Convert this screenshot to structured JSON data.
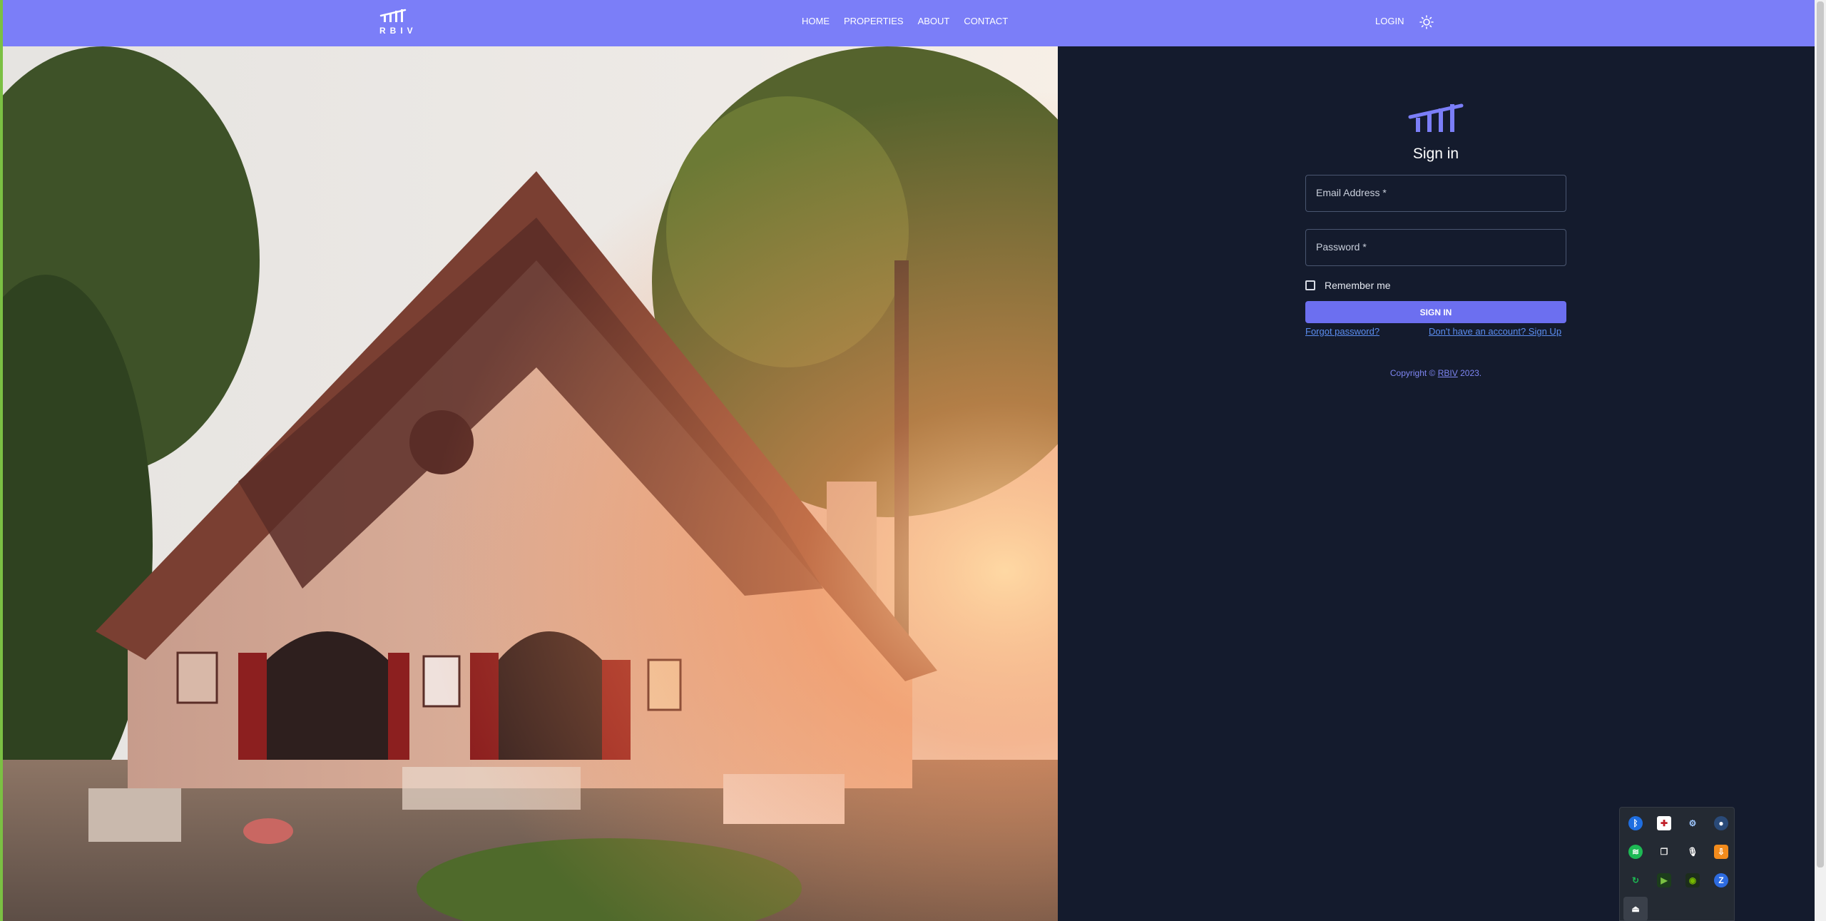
{
  "navbar": {
    "brand_text": "RBIV",
    "links": [
      "HOME",
      "PROPERTIES",
      "ABOUT",
      "CONTACT"
    ],
    "login_label": "LOGIN",
    "theme_icon": "sun-icon",
    "background_color": "#7b7ef8"
  },
  "signin": {
    "title": "Sign in",
    "email_label": "Email Address *",
    "password_label": "Password *",
    "remember_label": "Remember me",
    "remember_checked": false,
    "button_label": "SIGN IN",
    "forgot_label": "Forgot password?",
    "signup_label": "Don't have an account? Sign Up",
    "copyright_prefix": "Copyright ©",
    "copyright_brand": "RBIV",
    "copyright_suffix": "2023.",
    "accent_color": "#6c6ff0",
    "link_color": "#5b8def",
    "panel_background": "#141b2d"
  },
  "hero": {
    "icon": "house-photo"
  },
  "tray": {
    "icons": [
      "bluetooth-icon",
      "security-shield-icon",
      "steam-icon",
      "circle-app-icon",
      "spotify-icon",
      "copy-app-icon",
      "microphone-icon",
      "orange-app-icon",
      "refresh-app-icon",
      "play-app-icon",
      "nvidia-icon",
      "zoom-icon",
      "usb-icon"
    ]
  }
}
